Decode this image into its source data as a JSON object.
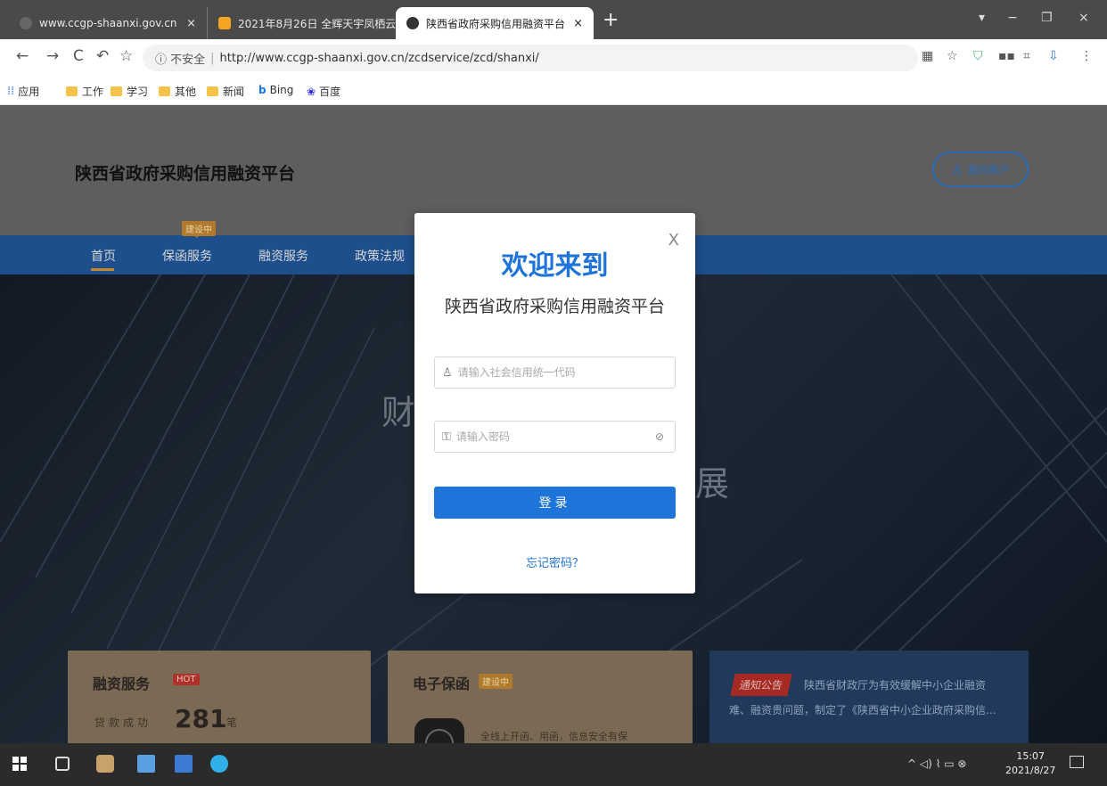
{
  "browser": {
    "tabs": [
      {
        "title": "www.ccgp-shaanxi.gov.cn"
      },
      {
        "title": "2021年8月26日 全辉天宇凤栖云"
      },
      {
        "title": "陕西省政府采购信用融资平台"
      }
    ],
    "tab_close": "×",
    "new_tab": "+",
    "window_controls": {
      "minimize": "−",
      "maximize": "❐",
      "close": "×"
    },
    "nav": {
      "back": "←",
      "forward": "→",
      "reload": "C",
      "undo": "↶",
      "bookmark": "☆"
    },
    "address": {
      "security_label": "ⓘ 不安全",
      "separator": "|",
      "url": "http://www.ccgp-shaanxi.gov.cn/zcdservice/zcd/shanxi/"
    },
    "bookmarks": [
      {
        "label": "应用",
        "icon": "apps-icon"
      },
      {
        "label": "工作",
        "icon": "folder-icon"
      },
      {
        "label": "学习",
        "icon": "folder-icon"
      },
      {
        "label": "其他",
        "icon": "folder-icon"
      },
      {
        "label": "新闻",
        "icon": "folder-icon"
      },
      {
        "label": "Bing",
        "icon": "bing-icon"
      },
      {
        "label": "百度",
        "icon": "baidu-icon"
      }
    ]
  },
  "site": {
    "title": "陕西省政府采购信用融资平台",
    "account_button": "我的账户",
    "nav_items": [
      "首页",
      "保函服务",
      "融资服务",
      "政策法规"
    ],
    "building_badge": "建设中",
    "hero_text": [
      "财",
      "展"
    ],
    "cards": {
      "financing": {
        "title": "融资服务",
        "badge": "HOT",
        "loan_label": "贷款成功",
        "loan_count": "281",
        "loan_unit": "笔"
      },
      "guarantee": {
        "title": "电子保函",
        "badge": "建设中",
        "text": "全线上开函、用函，信息安全有保"
      },
      "notice": {
        "tag": "通知公告",
        "line1": "陕西省财政厅为有效缓解中小企业融资",
        "line2": "难、融资贵问题，制定了《陕西省中小企业政府采购信..."
      }
    }
  },
  "login_modal": {
    "close": "X",
    "welcome": "欢迎来到",
    "platform": "陕西省政府采购信用融资平台",
    "username_placeholder": "请输入社会信用统一代码",
    "password_placeholder": "请输入密码",
    "login_button": "登录",
    "forgot_link": "忘记密码？"
  },
  "taskbar": {
    "time": "15:07",
    "date": "2021/8/27",
    "tray": "^ ◁) ⌇ ▭ ⊗"
  },
  "colors": {
    "primary_blue": "#1e74d8",
    "nav_blue": "#1d4f8d",
    "accent_gold": "#c0872c"
  }
}
